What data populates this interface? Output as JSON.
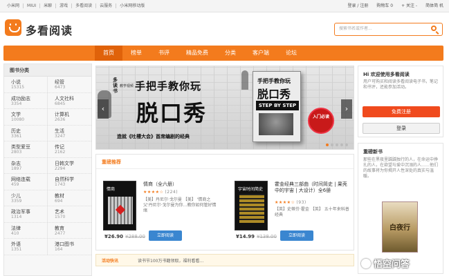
{
  "topbar": {
    "links": [
      "小米网",
      "MIUI",
      "米聊",
      "游戏",
      "多看阅读",
      "云服务",
      "小米网移动版"
    ],
    "login_register": "登录 / 注册",
    "cart": "购物车 0",
    "follow": "+ 关注 -",
    "language": "简体简 机"
  },
  "logo_text": "多看阅读",
  "search": {
    "placeholder": "搜索书名或作者..."
  },
  "nav": {
    "items": [
      "首页",
      "榜单",
      "书评",
      "精品免费",
      "分类",
      "客户端",
      "论坛"
    ],
    "active_index": 0
  },
  "sidebar": {
    "title": "图书分类",
    "categories": [
      {
        "name": "小说",
        "count": "15315"
      },
      {
        "name": "经管",
        "count": "6473"
      },
      {
        "name": "成功励志",
        "count": "3354"
      },
      {
        "name": "人文社科",
        "count": "6845"
      },
      {
        "name": "文学",
        "count": "10080"
      },
      {
        "name": "计算机",
        "count": "2636"
      },
      {
        "name": "历史",
        "count": "3361"
      },
      {
        "name": "生活",
        "count": "3247"
      },
      {
        "name": "类型爱豆",
        "count": "2803"
      },
      {
        "name": "传记",
        "count": "2162"
      },
      {
        "name": "杂志",
        "count": "1897"
      },
      {
        "name": "日韩文学",
        "count": "2294"
      },
      {
        "name": "网络连载",
        "count": "459"
      },
      {
        "name": "自然科学",
        "count": "1743"
      },
      {
        "name": "少儿",
        "count": "3359"
      },
      {
        "name": "教材",
        "count": "694"
      },
      {
        "name": "政治军事",
        "count": "1314"
      },
      {
        "name": "艺术",
        "count": "1570"
      },
      {
        "name": "法律",
        "count": "410"
      },
      {
        "name": "教育",
        "count": "2477"
      },
      {
        "name": "外语",
        "count": "1351"
      },
      {
        "name": "港口图书",
        "count": "164"
      }
    ]
  },
  "banner": {
    "side_text": "多读书",
    "tag_text": "教学视频",
    "small_text": "大王",
    "title_line1": "手把手教你玩",
    "title_line2": "脱口秀",
    "subtitle": "造就《吐槽大会》首席编剧的经典",
    "book_line1": "手把手教你玩",
    "book_line2": "脱口秀",
    "book_strip": "STEP BY STEP",
    "stamp_text": "入门必读",
    "arrow_left": "‹",
    "arrow_right": "›"
  },
  "recommend": {
    "heading": "重磅推荐",
    "books": [
      {
        "cover_text": "情商",
        "title": "情商（全六册）",
        "stars": "★★★★☆",
        "rating_count": "(224)",
        "desc": "【美】丹尼尔·戈尔曼 【美】 '情商之父'丹尼尔·戈尔曼为你…教你如何管好情绪",
        "price": "¥26.90",
        "old_price": "¥288.00",
        "button": "立即阅读"
      },
      {
        "cover_text": "宇宙时间简史",
        "title": "霍金经典三部曲（时间简史 | 果壳中的宇宙 | 大设计）全6册",
        "stars": "★★★★☆",
        "rating_count": "(93)",
        "desc": "【英】史蒂芬·霍金 【英】 五十年来科普经典",
        "price": "¥14.99",
        "old_price": "¥138.00",
        "button": "立即阅读"
      }
    ]
  },
  "news": {
    "label": "活动快讯",
    "text": "读书节100万书籍领取，福利看看…"
  },
  "welcome": {
    "title": "Hi 欢迎使用多看阅读",
    "text": "用户可购买和阅读多看阅读电子书，笔记和书评，还能参加活动。",
    "register": "免费注册",
    "login": "登录"
  },
  "rebook": {
    "title": "重磅新书",
    "text": "那些在黑夜里踽踽独行的人，在命运中挣扎的人，在欲望与爱中沉溺的人……他们的故事将为你揭开人性深处的真实与温暖。",
    "cover_text": "白夜行"
  },
  "watermark": "悟空问答"
}
